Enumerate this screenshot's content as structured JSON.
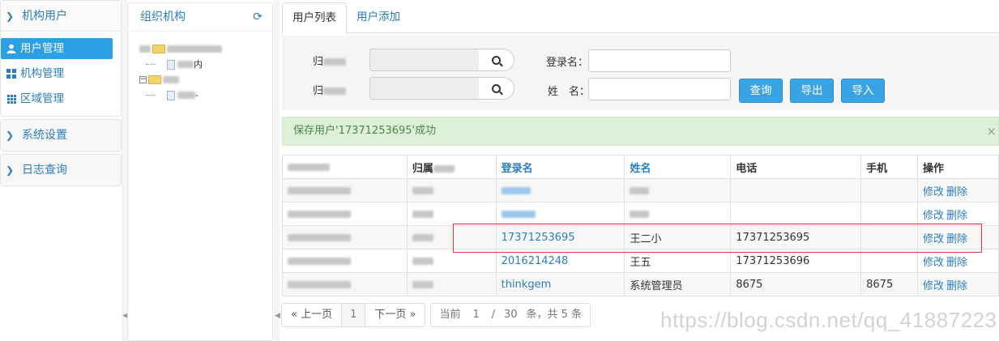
{
  "sidebar": {
    "section_org": "机构用户",
    "items": [
      {
        "label": "用户管理",
        "icon": "user-icon",
        "active": true
      },
      {
        "label": "机构管理",
        "icon": "grid-icon",
        "active": false
      },
      {
        "label": "区域管理",
        "icon": "grid9-icon",
        "active": false
      }
    ],
    "section_settings": "系统设置",
    "section_logs": "日志查询"
  },
  "tree": {
    "title": "组织机构",
    "refresh_icon": "refresh-icon",
    "child1_suffix": "内",
    "child3_suffix": "-"
  },
  "tabs": [
    {
      "label": "用户列表",
      "active": true
    },
    {
      "label": "用户添加",
      "active": false
    }
  ],
  "search": {
    "label_belong1": "归",
    "label_belong2": "归",
    "label_login": "登录名：",
    "label_name": "姓　名：",
    "btn_query": "查询",
    "btn_export": "导出",
    "btn_import": "导入"
  },
  "alert": {
    "message": "保存用户'17371253695'成功",
    "close": "×"
  },
  "table": {
    "headers": [
      "",
      "归属",
      "登录名",
      "姓名",
      "电话",
      "手机",
      "操作"
    ],
    "rows": [
      {
        "login": "",
        "name": "",
        "phone": "",
        "mobile": ""
      },
      {
        "login": "",
        "name": "",
        "phone": "",
        "mobile": ""
      },
      {
        "login": "17371253695",
        "name": "王二小",
        "phone": "17371253695",
        "mobile": ""
      },
      {
        "login": "2016214248",
        "name": "王五",
        "phone": "17371253696",
        "mobile": ""
      },
      {
        "login": "thinkgem",
        "name": "系统管理员",
        "phone": "8675",
        "mobile": "8675"
      }
    ],
    "op_edit": "修改",
    "op_delete": "删除"
  },
  "pager": {
    "prev": "« 上一页",
    "current": "1",
    "next": "下一页 »",
    "info_prefix": "当前",
    "page_input": "1",
    "slash": "/",
    "page_size": "30",
    "info_suffix": "条，共 5 条"
  },
  "watermark": "https://blog.csdn.net/qq_41887223",
  "colors": {
    "accent": "#2c7dc0",
    "active_bg": "#2ca0e4",
    "button_bg": "#3aa3e3",
    "alert_bg": "#dff0d8",
    "alert_text": "#468847",
    "highlight_border": "#d9363e"
  }
}
